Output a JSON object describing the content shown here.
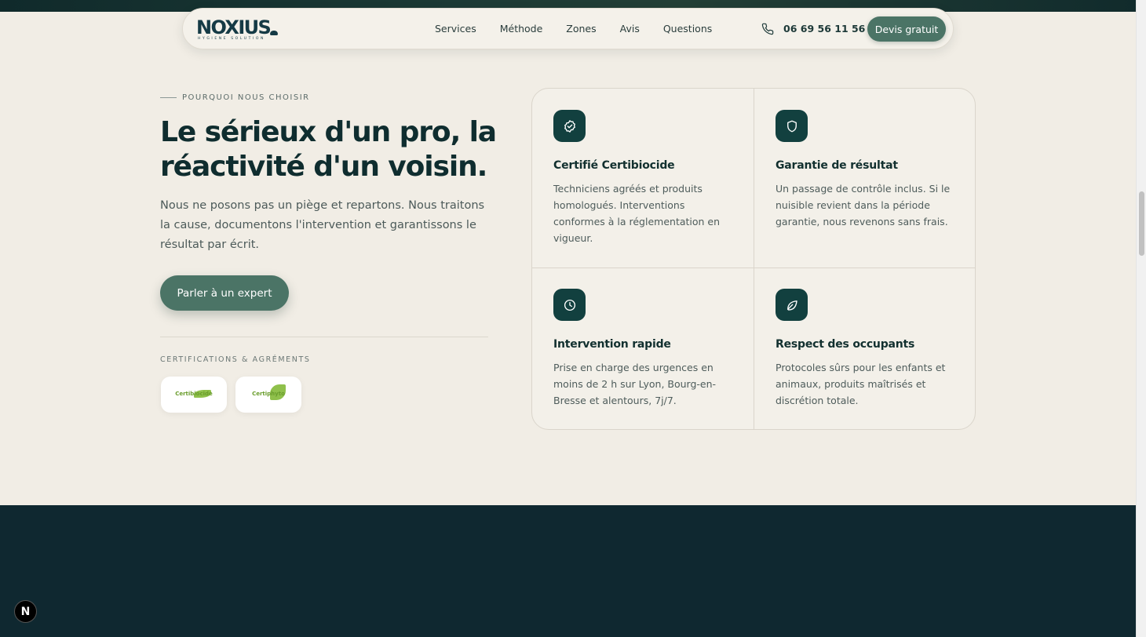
{
  "nav": {
    "logo_text": "NOXIUS",
    "logo_tagline": "HYGIENE SOLUTION",
    "links": [
      "Services",
      "Méthode",
      "Zones",
      "Avis",
      "Questions"
    ],
    "phone": "06 69 56 11 56",
    "cta": "Devis gratuit"
  },
  "hero": {
    "eyebrow": "POURQUOI NOUS CHOISIR",
    "headline": "Le sérieux d'un pro, la réactivité d'un voisin.",
    "lead": "Nous ne posons pas un piège et repartons. Nous traitons la cause, documentons l'intervention et garantissons le résultat par écrit.",
    "cta": "Parler à un expert",
    "cert_heading": "CERTIFICATIONS & AGRÉMENTS",
    "badges": [
      "Certibiocide",
      "Certiphyto"
    ]
  },
  "features": [
    {
      "icon": "badge-check-icon",
      "title": "Certifié Certibiocide",
      "desc": "Techniciens agréés et produits homologués. Interventions conformes à la réglementation en vigueur."
    },
    {
      "icon": "shield-icon",
      "title": "Garantie de résultat",
      "desc": "Un passage de contrôle inclus. Si le nuisible revient dans la période garantie, nous revenons sans frais."
    },
    {
      "icon": "clock-icon",
      "title": "Intervention rapide",
      "desc": "Prise en charge des urgences en moins de 2 h sur Lyon, Bourg-en-Bresse et alentours, 7j/7."
    },
    {
      "icon": "leaf-icon",
      "title": "Respect des occupants",
      "desc": "Protocoles sûrs pour les enfants et animaux, produits maîtrisés et discrétion totale."
    }
  ],
  "dev_badge": "N",
  "colors": {
    "brand": "#12403f",
    "accent": "#4b7466",
    "background": "#f1ede5",
    "dark": "#0f2830"
  }
}
